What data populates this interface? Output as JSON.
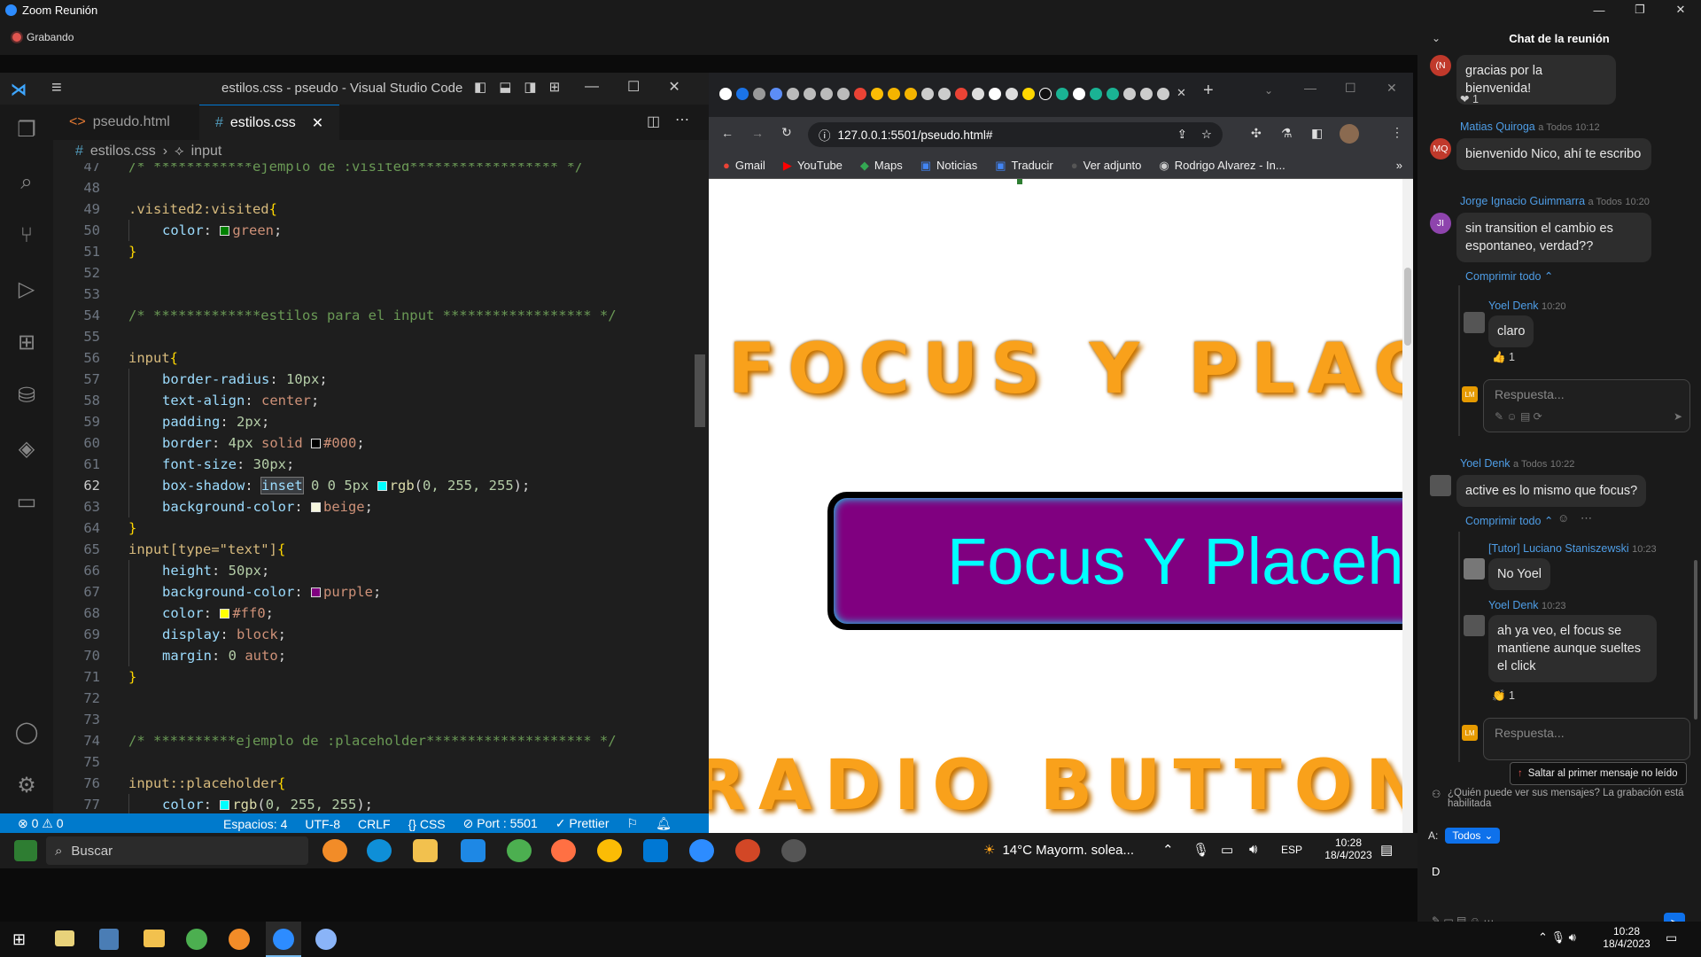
{
  "zoom": {
    "title": "Zoom Reunión",
    "recording": "Grabando"
  },
  "vscode": {
    "title": "estilos.css - pseudo - Visual Studio Code",
    "tabs": [
      "pseudo.html",
      "estilos.css"
    ],
    "breadcrumb": [
      "estilos.css",
      "input"
    ],
    "status": {
      "problems": "⊗ 0 ⚠ 0",
      "spaces": "Espacios: 4",
      "encoding": "UTF-8",
      "eol": "CRLF",
      "lang": "{} CSS",
      "port": "⊘ Port : 5501",
      "prettier": "✓ Prettier"
    },
    "lines": [
      {
        "n": "47",
        "segs": [
          [
            "cmt",
            "/* ************ejemplo de :visited****************** */"
          ]
        ]
      },
      {
        "n": "48",
        "segs": []
      },
      {
        "n": "49",
        "segs": [
          [
            "sel",
            ".visited2:visited"
          ],
          [
            "brc",
            "{"
          ]
        ]
      },
      {
        "n": "50",
        "segs": [
          [
            "ind",
            ""
          ],
          [
            "prop",
            "color"
          ],
          [
            "",
            ": "
          ],
          [
            "sw",
            "#008000"
          ],
          [
            "val",
            "green"
          ],
          [
            "",
            ";"
          ]
        ]
      },
      {
        "n": "51",
        "segs": [
          [
            "brc",
            "}"
          ]
        ]
      },
      {
        "n": "52",
        "segs": []
      },
      {
        "n": "53",
        "segs": []
      },
      {
        "n": "54",
        "segs": [
          [
            "cmt",
            "/* *************estilos para el input ****************** */"
          ]
        ]
      },
      {
        "n": "55",
        "segs": []
      },
      {
        "n": "56",
        "segs": [
          [
            "sel",
            "input"
          ],
          [
            "brc",
            "{"
          ]
        ]
      },
      {
        "n": "57",
        "segs": [
          [
            "ind",
            ""
          ],
          [
            "prop",
            "border-radius"
          ],
          [
            "",
            ": "
          ],
          [
            "num",
            "10px"
          ],
          [
            "",
            ";"
          ]
        ]
      },
      {
        "n": "58",
        "segs": [
          [
            "ind",
            ""
          ],
          [
            "prop",
            "text-align"
          ],
          [
            "",
            ": "
          ],
          [
            "val",
            "center"
          ],
          [
            "",
            ";"
          ]
        ]
      },
      {
        "n": "59",
        "segs": [
          [
            "ind",
            ""
          ],
          [
            "prop",
            "padding"
          ],
          [
            "",
            ": "
          ],
          [
            "num",
            "2px"
          ],
          [
            "",
            ";"
          ]
        ]
      },
      {
        "n": "60",
        "segs": [
          [
            "ind",
            ""
          ],
          [
            "prop",
            "border"
          ],
          [
            "",
            ": "
          ],
          [
            "num",
            "4px"
          ],
          [
            "val",
            " solid "
          ],
          [
            "sw",
            "#000000"
          ],
          [
            "val",
            "#000"
          ],
          [
            "",
            ";"
          ]
        ]
      },
      {
        "n": "61",
        "segs": [
          [
            "ind",
            ""
          ],
          [
            "prop",
            "font-size"
          ],
          [
            "",
            ": "
          ],
          [
            "num",
            "30px"
          ],
          [
            "",
            ";"
          ]
        ]
      },
      {
        "n": "62",
        "segs": [
          [
            "ind",
            ""
          ],
          [
            "prop",
            "box-shadow"
          ],
          [
            "",
            ": "
          ],
          [
            "hl",
            "inset"
          ],
          [
            "num",
            " 0 0 5px "
          ],
          [
            "sw",
            "#00ffff"
          ],
          [
            "fn",
            "rgb"
          ],
          [
            "",
            "("
          ],
          [
            "num",
            "0, 255, 255"
          ],
          [
            "",
            ");"
          ]
        ]
      },
      {
        "n": "63",
        "segs": [
          [
            "ind",
            ""
          ],
          [
            "prop",
            "background-color"
          ],
          [
            "",
            ": "
          ],
          [
            "sw",
            "#f5f5dc"
          ],
          [
            "val",
            "beige"
          ],
          [
            "",
            ";"
          ]
        ]
      },
      {
        "n": "64",
        "segs": [
          [
            "brc",
            "}"
          ]
        ]
      },
      {
        "n": "65",
        "segs": [
          [
            "sel",
            "input[type=\"text\"]"
          ],
          [
            "brc",
            "{"
          ]
        ]
      },
      {
        "n": "66",
        "segs": [
          [
            "ind",
            ""
          ],
          [
            "prop",
            "height"
          ],
          [
            "",
            ": "
          ],
          [
            "num",
            "50px"
          ],
          [
            "",
            ";"
          ]
        ]
      },
      {
        "n": "67",
        "segs": [
          [
            "ind",
            ""
          ],
          [
            "prop",
            "background-color"
          ],
          [
            "",
            ": "
          ],
          [
            "sw",
            "#800080"
          ],
          [
            "val",
            "purple"
          ],
          [
            "",
            ";"
          ]
        ]
      },
      {
        "n": "68",
        "segs": [
          [
            "ind",
            ""
          ],
          [
            "prop",
            "color"
          ],
          [
            "",
            ": "
          ],
          [
            "sw",
            "#ffff00"
          ],
          [
            "val",
            "#ff0"
          ],
          [
            "",
            ";"
          ]
        ]
      },
      {
        "n": "69",
        "segs": [
          [
            "ind",
            ""
          ],
          [
            "prop",
            "display"
          ],
          [
            "",
            ": "
          ],
          [
            "val",
            "block"
          ],
          [
            "",
            ";"
          ]
        ]
      },
      {
        "n": "70",
        "segs": [
          [
            "ind",
            ""
          ],
          [
            "prop",
            "margin"
          ],
          [
            "",
            ": "
          ],
          [
            "num",
            "0"
          ],
          [
            "val",
            " auto"
          ],
          [
            "",
            ";"
          ]
        ]
      },
      {
        "n": "71",
        "segs": [
          [
            "brc",
            "}"
          ]
        ]
      },
      {
        "n": "72",
        "segs": []
      },
      {
        "n": "73",
        "segs": []
      },
      {
        "n": "74",
        "segs": [
          [
            "cmt",
            "/* **********ejemplo de :placeholder******************** */"
          ]
        ]
      },
      {
        "n": "75",
        "segs": []
      },
      {
        "n": "76",
        "segs": [
          [
            "sel",
            "input::placeholder"
          ],
          [
            "brc",
            "{"
          ]
        ]
      },
      {
        "n": "77",
        "segs": [
          [
            "ind",
            ""
          ],
          [
            "prop",
            "color"
          ],
          [
            "",
            ": "
          ],
          [
            "sw",
            "#00ffff"
          ],
          [
            "fn",
            "rgb"
          ],
          [
            "",
            "("
          ],
          [
            "num",
            "0, 255, 255"
          ],
          [
            "",
            ");"
          ]
        ]
      }
    ],
    "current_line": "62"
  },
  "browser": {
    "url": "127.0.0.1:5501/pseudo.html#",
    "bookmarks": [
      "Gmail",
      "YouTube",
      "Maps",
      "Noticias",
      "Traducir",
      "Ver adjunto",
      "Rodrigo Alvarez - In..."
    ],
    "heading1": "FOCUS Y PLACE",
    "input_text": "Focus Y Placeh",
    "heading2": "RADIO BUTTON"
  },
  "inner_taskbar": {
    "search": "Buscar",
    "weather": "14°C  Mayorm. solea...",
    "lang": "ESP",
    "time": "10:28",
    "date": "18/4/2023"
  },
  "chat": {
    "title": "Chat de la reunión",
    "messages": [
      {
        "text": "gracias por la bienvenida!",
        "reaction": "❤ 1"
      },
      {
        "name": "Matias Quiroga",
        "to": "a Todos",
        "time": "10:12",
        "initials": "MQ",
        "text": "bienvenido Nico, ahí te escribo"
      },
      {
        "name": "Jorge Ignacio Guimmarra",
        "to": "a Todos",
        "time": "10:20",
        "initials": "JI",
        "text": "sin transition el cambio es espontaneo, verdad??"
      },
      {
        "name": "Yoel Denk",
        "to": "a Todos",
        "time": "10:22",
        "text": "active es lo mismo que focus?"
      }
    ],
    "collapse": "Comprimir todo ⌃",
    "thread1": [
      {
        "name": "Yoel Denk",
        "time": "10:20",
        "text": "claro",
        "reaction": "👍 1"
      }
    ],
    "thread2": [
      {
        "name": "[Tutor] Luciano Staniszewski",
        "time": "10:23",
        "text": "No Yoel"
      },
      {
        "name": "Yoel Denk",
        "time": "10:23",
        "text": "ah ya veo, el focus se mantiene aunque sueltes el click",
        "reaction": "👏 1"
      }
    ],
    "reply_placeholder": "Respuesta...",
    "reply_initials": "LM",
    "jump": "Saltar al primer mensaje no leído",
    "privacy": "¿Quién puede ver sus mensajes? La grabación está habilitada",
    "to_label": "A:",
    "to_value": "Todos",
    "composer": "D"
  },
  "win_taskbar": {
    "time": "10:28",
    "date": "18/4/2023"
  }
}
